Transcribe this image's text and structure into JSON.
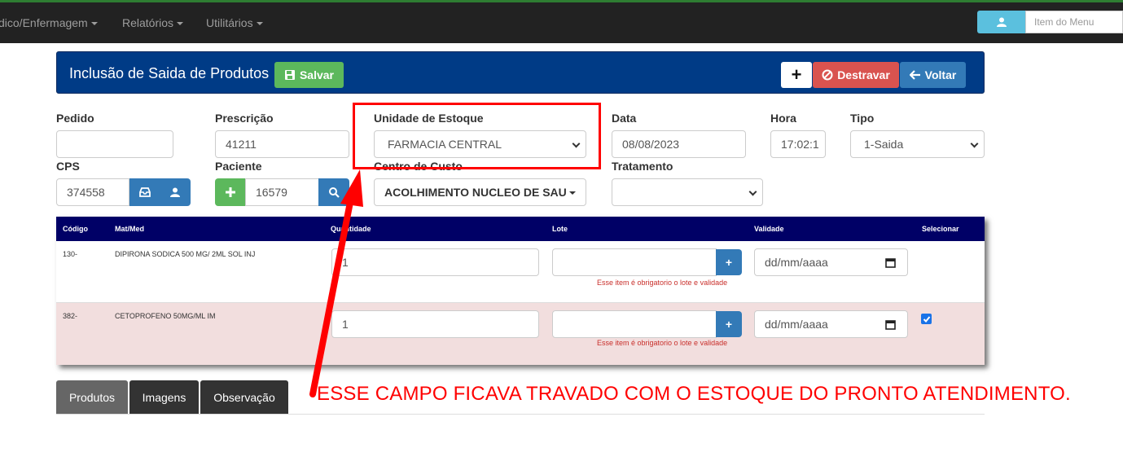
{
  "nav": {
    "items": [
      {
        "label": "dico/Enfermagem"
      },
      {
        "label": "Relatórios"
      },
      {
        "label": "Utilitários"
      }
    ],
    "menu_search_placeholder": "Item do Menu"
  },
  "header": {
    "title": "Inclusão de Saida de Produtos",
    "salvar_label": "Salvar",
    "plus_label": "+",
    "destravar_label": "Destravar",
    "voltar_label": "Voltar"
  },
  "form": {
    "pedido": {
      "label": "Pedido",
      "value": ""
    },
    "prescricao": {
      "label": "Prescrição",
      "value": "41211"
    },
    "unidade_estoque": {
      "label": "Unidade de Estoque",
      "value": "FARMACIA CENTRAL"
    },
    "data": {
      "label": "Data",
      "value": "08/08/2023"
    },
    "hora": {
      "label": "Hora",
      "value": "17:02:1"
    },
    "tipo": {
      "label": "Tipo",
      "value": "1-Saida"
    },
    "cps": {
      "label": "CPS",
      "value": "374558"
    },
    "paciente": {
      "label": "Paciente",
      "value": "16579"
    },
    "centro_custo": {
      "label": "Centro de Custo",
      "value": "ACOLHIMENTO NUCLEO DE SAU"
    },
    "tratamento": {
      "label": "Tratamento",
      "value": ""
    }
  },
  "table": {
    "headers": {
      "codigo": "Código",
      "matmed": "Mat/Med",
      "quantidade": "Quantidade",
      "lote": "Lote",
      "validade": "Validade",
      "selecionar": "Selecionar"
    },
    "rows": [
      {
        "codigo": "130-",
        "matmed": "DIPIRONA SODICA 500 MG/ 2ML SOL INJ",
        "quantidade": "1",
        "lote": "",
        "validade_placeholder": "dd/mm/aaaa",
        "lote_btn": "+",
        "warning": "Esse item é obrigatorio o lote e validade",
        "selected": false
      },
      {
        "codigo": "382-",
        "matmed": "CETOPROFENO 50MG/ML IM",
        "quantidade": "1",
        "lote": "",
        "validade_placeholder": "dd/mm/aaaa",
        "lote_btn": "+",
        "warning": "Esse item é obrigatorio o lote e validade",
        "selected": true
      }
    ]
  },
  "tabs": [
    {
      "label": "Produtos",
      "active": true
    },
    {
      "label": "Imagens",
      "active": false
    },
    {
      "label": "Observação",
      "active": false
    }
  ],
  "annotation": {
    "text": "ESSE CAMPO FICAVA TRAVADO COM O ESTOQUE DO PRONTO ATENDIMENTO."
  },
  "colors": {
    "header_bg": "#003b86",
    "table_header_bg": "#000066",
    "success": "#5cb85c",
    "danger": "#d9534f",
    "primary": "#337ab7",
    "info": "#5bc0de",
    "annotation": "#ff0000",
    "selected_row": "#f2dede"
  }
}
